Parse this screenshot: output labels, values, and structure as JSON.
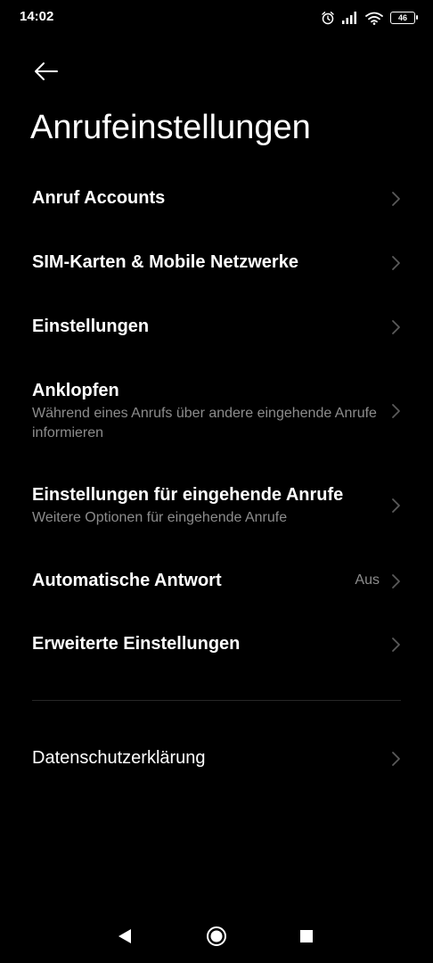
{
  "status_bar": {
    "time": "14:02",
    "battery_level": "46",
    "icons": [
      "alarm-icon",
      "signal-icon",
      "wifi-icon",
      "battery-icon"
    ]
  },
  "header": {
    "back_icon": "arrow-left-icon",
    "title": "Anrufeinstellungen"
  },
  "settings": {
    "items": [
      {
        "title": "Anruf Accounts"
      },
      {
        "title": "SIM-Karten & Mobile Netzwerke"
      },
      {
        "title": "Einstellungen"
      },
      {
        "title": "Anklopfen",
        "subtitle": "Während eines Anrufs über andere eingehende Anrufe informieren"
      },
      {
        "title": "Einstellungen für eingehende Anrufe",
        "subtitle": "Weitere Optionen für eingehende Anrufe"
      },
      {
        "title": "Automatische Antwort",
        "value": "Aus"
      },
      {
        "title": "Erweiterte Einstellungen"
      }
    ],
    "privacy": {
      "title": "Datenschutzerklärung"
    }
  },
  "nav_bar": {
    "icons": [
      "nav-back-icon",
      "nav-home-icon",
      "nav-recents-icon"
    ]
  },
  "colors": {
    "background": "#000000",
    "text_primary": "#ffffff",
    "text_secondary": "#8c8c8c",
    "chevron": "#5a5a5a",
    "divider": "#262626"
  }
}
